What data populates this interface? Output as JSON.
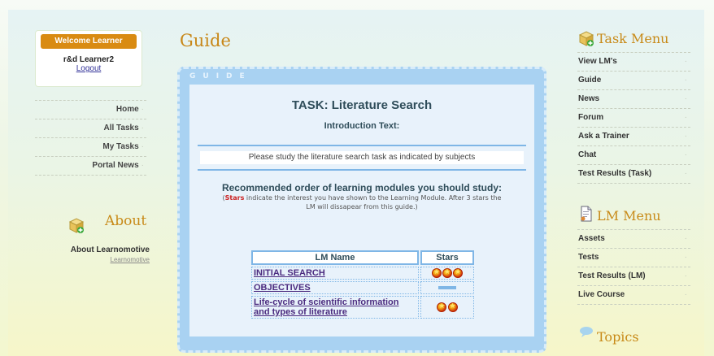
{
  "welcome": {
    "title": "Welcome Learner",
    "user": "r&d Learner2",
    "logout": "Logout"
  },
  "left_nav": [
    {
      "label": "Home"
    },
    {
      "label": "All Tasks"
    },
    {
      "label": "My Tasks"
    },
    {
      "label": "Portal News"
    }
  ],
  "about": {
    "title": "About",
    "link": "About Learnomotive",
    "sub": "Learnomotive"
  },
  "page_title": "Guide",
  "guide": {
    "label": "GUIDE",
    "task_title": "TASK: Literature Search",
    "intro_heading": "Introduction Text:",
    "intro_content": "Please study the literature search task as indicated by subjects",
    "recommend_title": "Recommended order of learning modules you should study:",
    "note_stars": "Stars",
    "note_rest": " indicate the interest you have shown to the Learning Module. After 3 stars the LM will dissapear from this guide.)",
    "table_headers": [
      "LM Name",
      "Stars"
    ],
    "rows": [
      {
        "name": "INITIAL SEARCH",
        "stars": 3
      },
      {
        "name": "OBJECTIVES",
        "stars": 0
      },
      {
        "name": "Life-cycle of scientific information and types of literature",
        "stars": 2
      }
    ]
  },
  "task_menu": {
    "title": "Task Menu",
    "items": [
      "View LM's",
      "Guide",
      "News",
      "Forum",
      "Ask a Trainer",
      "Chat",
      "Test Results (Task)"
    ]
  },
  "lm_menu": {
    "title": "LM Menu",
    "items": [
      "Assets",
      "Tests",
      "Test Results (LM)",
      "Live Course"
    ]
  },
  "topics": {
    "title": "Topics"
  },
  "colors": {
    "accent": "#d98b12",
    "heading": "#c88a18",
    "guide_bg": "#a9d2f2",
    "link": "#4b2b7f"
  }
}
